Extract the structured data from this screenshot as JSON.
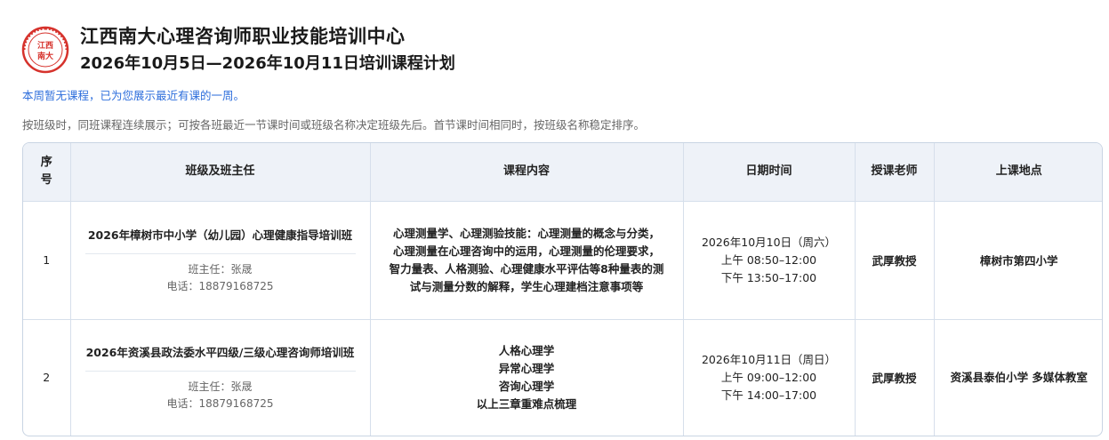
{
  "header": {
    "logo_text": "江西南大",
    "title": "江西南大心理咨询师职业技能培训中心",
    "subtitle": "2026年10月5日—2026年10月11日培训课程计划"
  },
  "notice": "本周暂无课程，已为您展示最近有课的一周。",
  "hint": "按班级时，同班课程连续展示；可按各班最近一节课时间或班级名称决定班级先后。首节课时间相同时，按班级名称稳定排序。",
  "table": {
    "headers": {
      "index_line1": "序",
      "index_line2": "号",
      "class": "班级及班主任",
      "course": "课程内容",
      "datetime": "日期时间",
      "teacher": "授课老师",
      "location": "上课地点"
    },
    "rows": [
      {
        "index": "1",
        "class_name": "2026年樟树市中小学（幼儿园）心理健康指导培训班",
        "head_teacher": "班主任：张晟",
        "phone": "电话：18879168725",
        "course": "心理测量学、心理测验技能：心理测量的概念与分类，心理测量在心理咨询中的运用，心理测量的伦理要求，智力量表、人格测验、心理健康水平评估等8种量表的测试与测量分数的解释，学生心理建档注意事项等",
        "date": "2026年10月10日（周六）",
        "time_am": "上午 08:50–12:00",
        "time_pm": "下午 13:50–17:00",
        "teacher": "武厚教授",
        "location": "樟树市第四小学"
      },
      {
        "index": "2",
        "class_name": "2026年资溪县政法委水平四级/三级心理咨询师培训班",
        "head_teacher": "班主任：张晟",
        "phone": "电话：18879168725",
        "course_lines": [
          "人格心理学",
          "异常心理学",
          "咨询心理学",
          "以上三章重难点梳理"
        ],
        "date": "2026年10月11日（周日）",
        "time_am": "上午 09:00–12:00",
        "time_pm": "下午 14:00–17:00",
        "teacher": "武厚教授",
        "location": "资溪县泰伯小学 多媒体教室"
      }
    ]
  },
  "colors": {
    "logo_red": "#d6322c",
    "notice_blue": "#2f6fdc",
    "header_bg": "#eef2f8",
    "border": "#c9d4e3"
  }
}
